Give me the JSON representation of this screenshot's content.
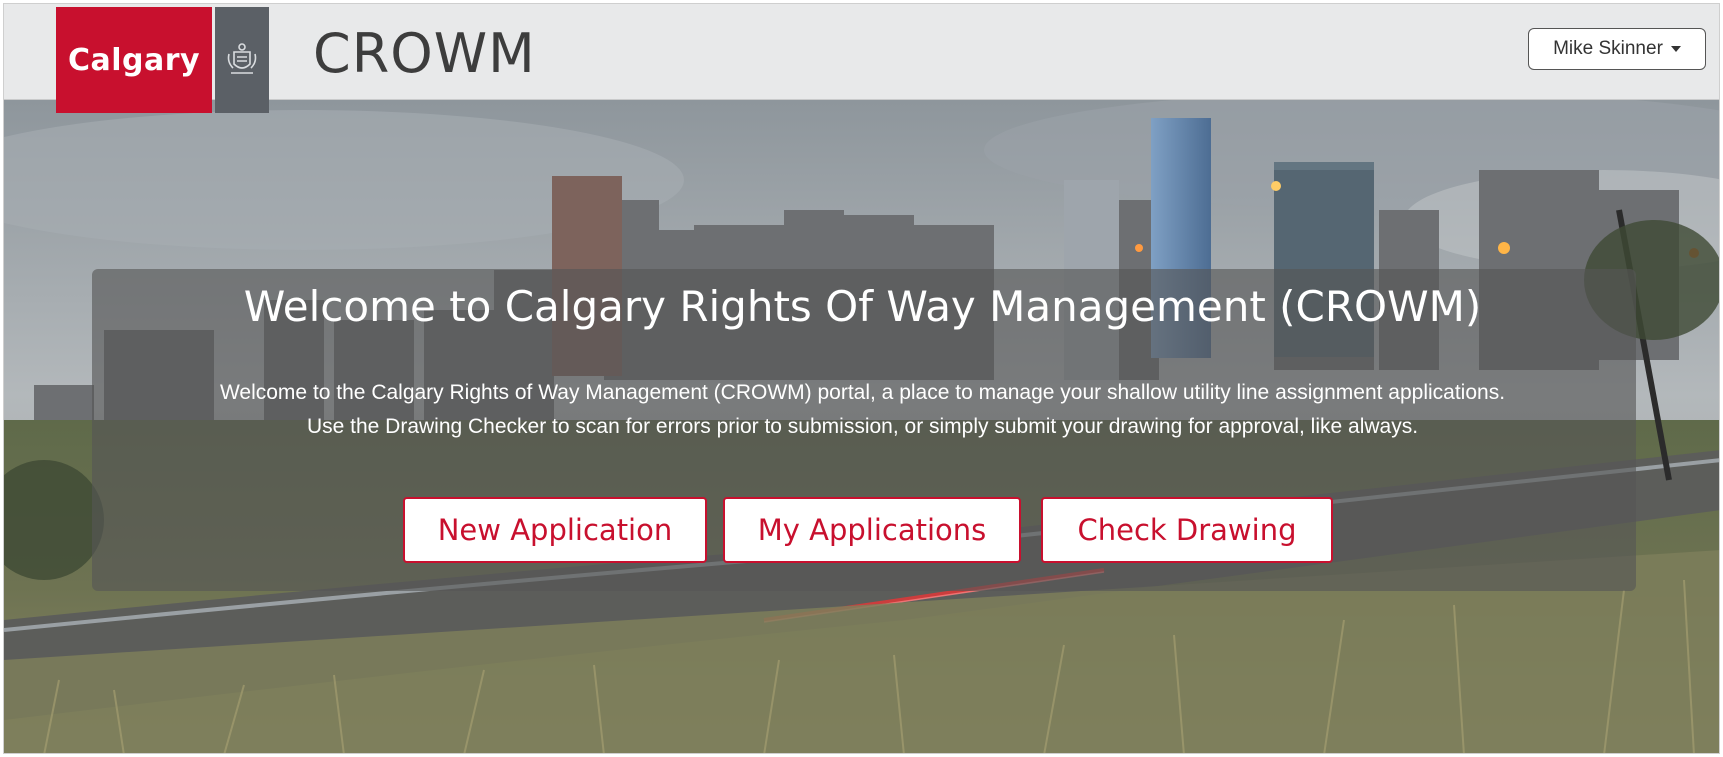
{
  "header": {
    "logo_text": "Calgary",
    "crest_icon": "city-crest-icon",
    "app_title": "CROWM",
    "user_menu_label": "Mike Skinner"
  },
  "hero": {
    "title": "Welcome to Calgary Rights Of Way Management (CROWM)",
    "description_line1": "Welcome to the Calgary Rights of Way Management (CROWM) portal, a place to manage your shallow utility line assignment applications.",
    "description_line2": "Use the Drawing Checker to scan for errors prior to submission, or simply submit your drawing for approval, like always.",
    "buttons": [
      {
        "label": "New Application"
      },
      {
        "label": "My Applications"
      },
      {
        "label": "Check Drawing"
      }
    ]
  },
  "colors": {
    "brand_red": "#c8102e",
    "header_bg": "#e8e9ea",
    "logo_grey": "#5b6066"
  }
}
